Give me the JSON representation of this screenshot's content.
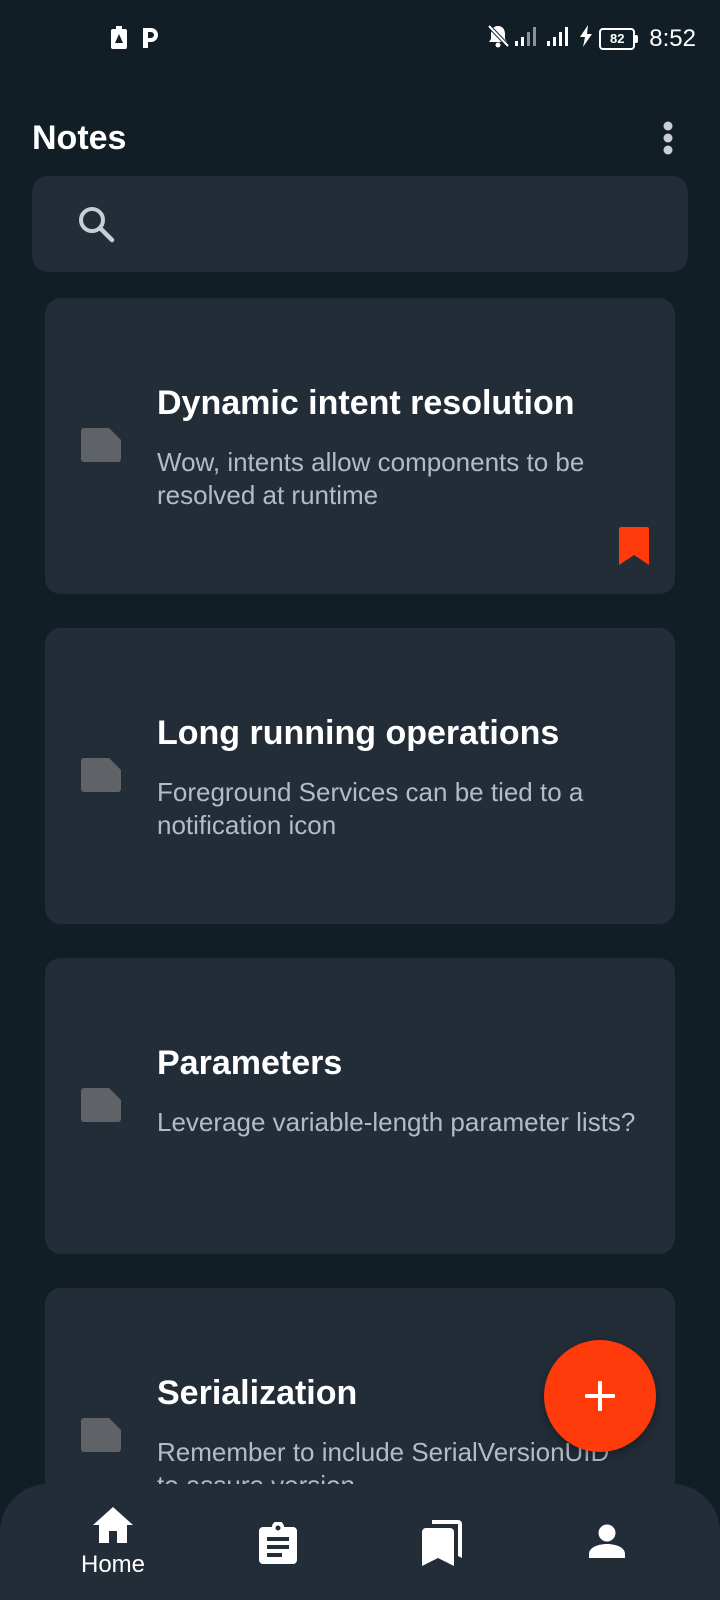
{
  "status_bar": {
    "time": "8:52",
    "battery": "82"
  },
  "header": {
    "title": "Notes"
  },
  "search": {
    "placeholder": ""
  },
  "notes": [
    {
      "title": "Dynamic intent resolution",
      "body": "Wow, intents allow components to be resolved at runtime",
      "bookmarked": true
    },
    {
      "title": "Long running operations",
      "body": "Foreground Services can be tied to a notification icon",
      "bookmarked": false
    },
    {
      "title": "Parameters",
      "body": "Leverage variable-length parameter lists?",
      "bookmarked": false
    },
    {
      "title": "Serialization",
      "body": "Remember to include SerialVersionUID to assure version",
      "bookmarked": false
    }
  ],
  "colors": {
    "background": "#121e26",
    "card": "#232d38",
    "accent": "#ff3a0b",
    "secondary_text": "#b3bcc4",
    "note_icon": "#5f6368"
  },
  "bottom_nav": {
    "items": [
      {
        "icon": "home-icon",
        "label": "Home"
      },
      {
        "icon": "clipboard-icon",
        "label": ""
      },
      {
        "icon": "bookmarks-icon",
        "label": ""
      },
      {
        "icon": "person-icon",
        "label": ""
      }
    ]
  }
}
